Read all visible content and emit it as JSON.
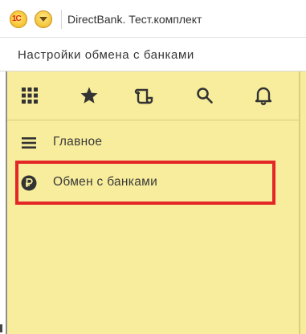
{
  "window": {
    "title": "DirectBank. Тест.комплект",
    "logo_icon": "1c-logo-icon",
    "menu_icon": "main-menu-icon"
  },
  "form": {
    "title": "Настройки обмена с банками"
  },
  "toolbar": {
    "icons": [
      "apps-grid-icon",
      "star-icon",
      "history-icon",
      "search-icon",
      "bell-icon"
    ]
  },
  "sidebar": {
    "items": [
      {
        "label": "Главное",
        "icon": "menu-lines-icon",
        "selected": false
      },
      {
        "label": "Обмен с банками",
        "icon": "ruble-icon",
        "selected": true
      }
    ]
  },
  "colors": {
    "panel_bg": "#f7ed9c",
    "highlight_border": "#e32626",
    "text": "#3a3a3a"
  }
}
